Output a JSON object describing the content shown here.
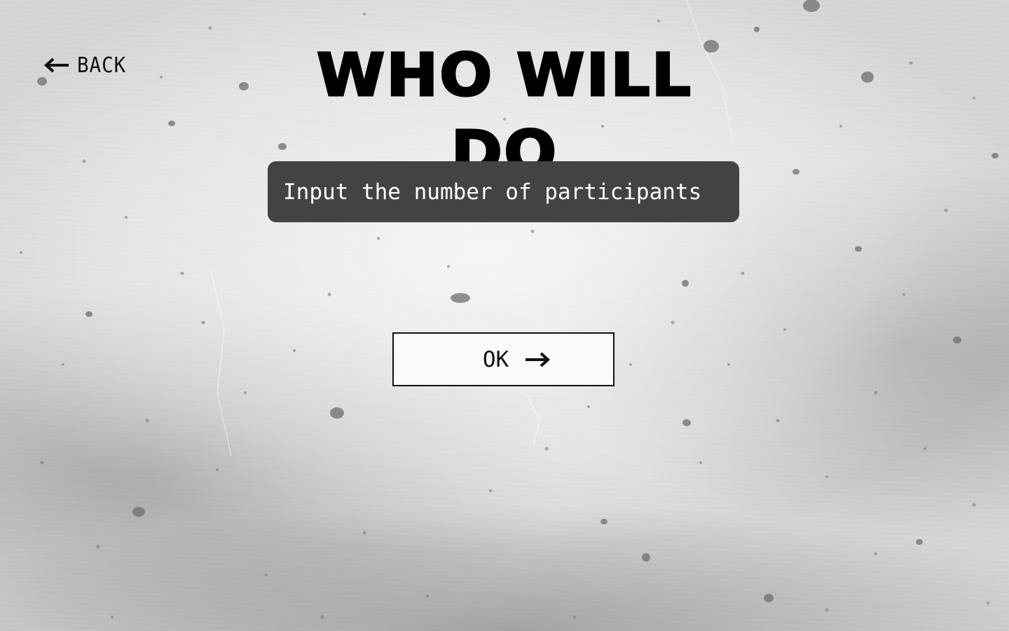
{
  "nav": {
    "back_label": "BACK",
    "back_icon": "arrow-left-icon"
  },
  "header": {
    "title": "WHO WILL DO"
  },
  "form": {
    "participants_placeholder": "Input the number of participants",
    "participants_value": "",
    "ok_label": "OK",
    "ok_icon": "arrow-right-icon"
  },
  "colors": {
    "input_background": "#444243",
    "input_text": "#ffffff",
    "button_background": "#fafafa",
    "button_border": "#111111",
    "title": "#000000"
  }
}
